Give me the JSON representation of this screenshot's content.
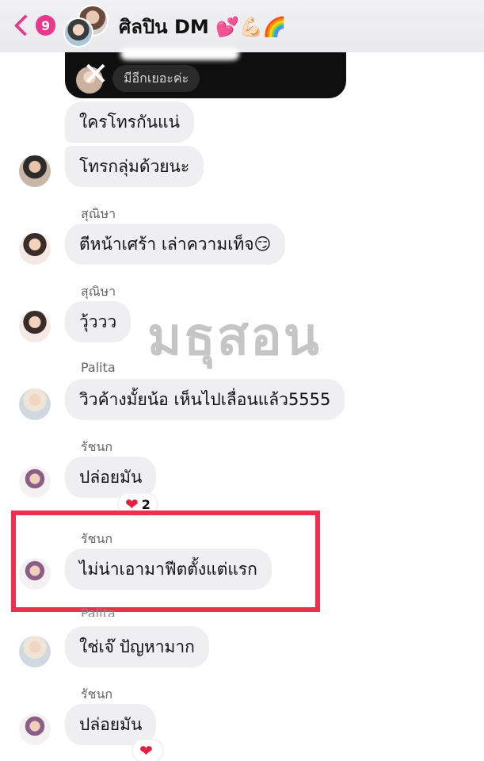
{
  "header": {
    "back_count": "9",
    "title": "ศิลปิน DM 💕💪🏻🌈"
  },
  "shared_card": {
    "more_label": "มีอีกเยอะค่ะ"
  },
  "watermark": "มธุสอน",
  "messages": [
    {
      "text": "ใครโทรกันแน่"
    },
    {
      "text": "โทรกลุ่มด้วยนะ"
    },
    {
      "sender": "สุณิษา",
      "text": "ตีหน้าเศร้า เล่าความเท็จ😏"
    },
    {
      "sender": "สุณิษา",
      "text": "วุ้ววว"
    },
    {
      "sender": "Palita",
      "text": "วิวค้างมั้ยน้อ เห็นไปเลื่อนแล้ว5555"
    },
    {
      "sender": "รัชนก",
      "text": "ปล่อยมัน",
      "reaction": {
        "emoji": "❤️",
        "count": "2"
      }
    },
    {
      "sender": "รัชนก",
      "text": "ไม่น่าเอามาฟีตตั้งแต่แรก"
    },
    {
      "sender": "Palita",
      "text": "ใช่เจ๊ ปัญหามาก"
    },
    {
      "sender": "รัชนก",
      "text": "ปล่อยมัน",
      "reaction": {
        "emoji": "❤️"
      }
    }
  ],
  "colors": {
    "accent": "#e53a8d",
    "highlight": "#ef2f4f",
    "bubble": "#efeff2"
  }
}
